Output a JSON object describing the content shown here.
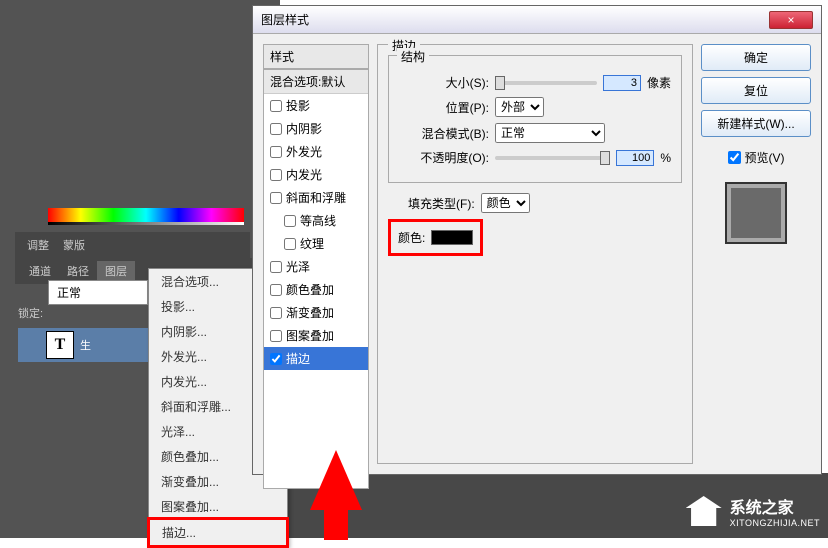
{
  "photoshop": {
    "tabs1": {
      "a": "调整",
      "b": "蒙版"
    },
    "tabs2": {
      "a": "通道",
      "b": "路径",
      "c": "图层"
    },
    "blendMode": "正常",
    "lockLabel": "锁定:",
    "layer": {
      "letter": "T",
      "name": "生"
    },
    "eye": "●"
  },
  "contextMenu": {
    "items": [
      "混合选项...",
      "投影...",
      "内阴影...",
      "外发光...",
      "内发光...",
      "斜面和浮雕...",
      "光泽...",
      "颜色叠加...",
      "渐变叠加...",
      "图案叠加...",
      "描边..."
    ]
  },
  "dialog": {
    "title": "图层样式",
    "close": "×",
    "stylesHeader": "样式",
    "defaultOptions": "混合选项:默认",
    "styleItems": [
      "投影",
      "内阴影",
      "外发光",
      "内发光",
      "斜面和浮雕",
      "等高线",
      "纹理",
      "光泽",
      "颜色叠加",
      "渐变叠加",
      "图案叠加",
      "描边"
    ],
    "panelTitle": "描边",
    "group1": "结构",
    "sizeLabel": "大小(S):",
    "sizeValue": "3",
    "sizeUnit": "像素",
    "posLabel": "位置(P):",
    "posValue": "外部",
    "blendLabel": "混合模式(B):",
    "blendValue": "正常",
    "opacityLabel": "不透明度(O):",
    "opacityValue": "100",
    "opacityUnit": "%",
    "fillTypeLabel": "填充类型(F):",
    "fillTypeValue": "颜色",
    "colorLabel": "颜色:",
    "buttons": {
      "ok": "确定",
      "cancel": "复位",
      "newStyle": "新建样式(W)...",
      "preview": "预览(V)"
    }
  },
  "watermark": {
    "cn": "系统之家",
    "en": "XITONGZHIJIA.NET"
  }
}
